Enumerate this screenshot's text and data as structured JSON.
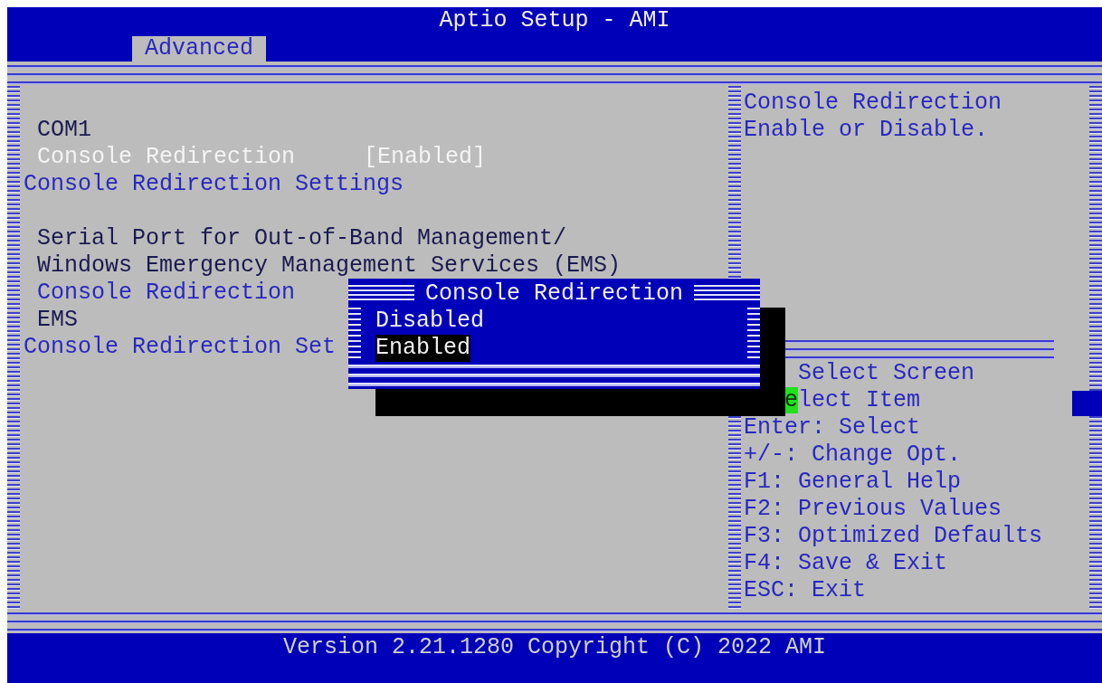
{
  "window": {
    "title": "Aptio Setup - AMI"
  },
  "tabs": [
    {
      "label": "Advanced",
      "selected": true
    }
  ],
  "items": [
    {
      "kind": "header",
      "label": "COM1"
    },
    {
      "kind": "setting",
      "label": "Console Redirection",
      "value": "[Enabled]",
      "selected": true
    },
    {
      "kind": "submenu",
      "label": "Console Redirection Settings",
      "selected": false
    },
    {
      "kind": "blank"
    },
    {
      "kind": "header",
      "label": "Serial Port for Out-of-Band Management/"
    },
    {
      "kind": "header",
      "label": "Windows Emergency Management Services (EMS)"
    },
    {
      "kind": "setting",
      "label": "Console Redirection",
      "selected": false
    },
    {
      "kind": "header",
      "label": "EMS"
    },
    {
      "kind": "submenu",
      "label": "Console Redirection Set",
      "selected": false
    }
  ],
  "help": [
    "Console Redirection",
    "Enable or Disable."
  ],
  "keys": [
    {
      "text": "Select Screen",
      "obscured": true,
      "cursor": false
    },
    {
      "text": "elect Item",
      "obscured": true,
      "cursor": true
    },
    {
      "text": "Enter: Select",
      "obscured": false,
      "cursor": false
    },
    {
      "text": "+/-: Change Opt.",
      "obscured": false,
      "cursor": false
    },
    {
      "text": "F1: General Help",
      "obscured": false,
      "cursor": false
    },
    {
      "text": "F2: Previous Values",
      "obscured": false,
      "cursor": false
    },
    {
      "text": "F3: Optimized Defaults",
      "obscured": false,
      "cursor": false
    },
    {
      "text": "F4: Save & Exit",
      "obscured": false,
      "cursor": false
    },
    {
      "text": "ESC: Exit",
      "obscured": false,
      "cursor": false
    }
  ],
  "popup": {
    "title": "Console Redirection",
    "options": [
      {
        "label": "Disabled",
        "selected": false
      },
      {
        "label": "Enabled",
        "selected": true
      }
    ]
  },
  "status_bar": "Version 2.21.1280 Copyright (C) 2022 AMI"
}
